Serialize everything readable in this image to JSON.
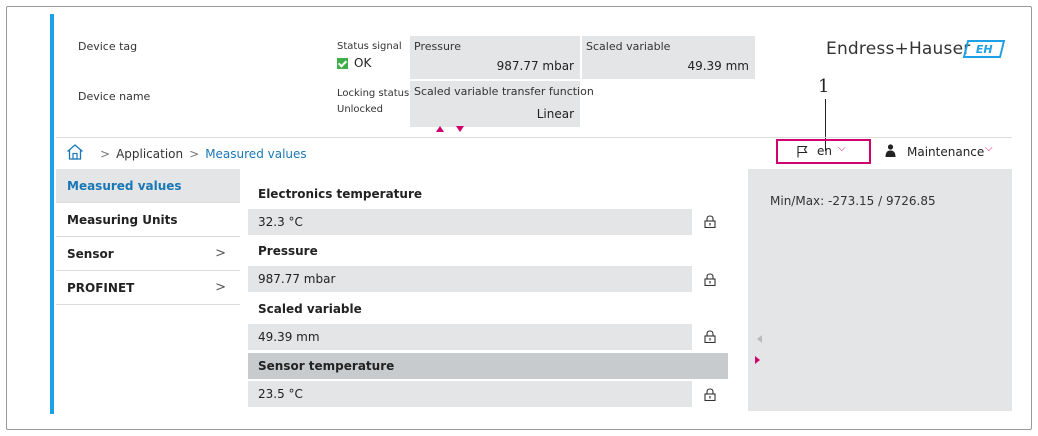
{
  "header": {
    "device_tag_label": "Device tag",
    "device_name_label": "Device name",
    "status_signal_label": "Status signal",
    "status_signal_value": "OK",
    "locking_status_label": "Locking status",
    "locking_status_value": "Unlocked",
    "tiles": {
      "pressure": {
        "label": "Pressure",
        "value": "987.77 mbar"
      },
      "scaled_variable": {
        "label": "Scaled variable",
        "value": "49.39 mm"
      },
      "transfer_function": {
        "label": "Scaled variable transfer function",
        "value": "Linear"
      }
    },
    "brand": "Endress+Hauser",
    "logo_text": "EH",
    "callout": "1"
  },
  "breadcrumb": {
    "items": [
      "Application",
      "Measured values"
    ],
    "separator": ">"
  },
  "toolbar": {
    "language": "en",
    "user_role": "Maintenance",
    "chevron": "⌵"
  },
  "sidebar": {
    "items": [
      {
        "label": "Measured values",
        "has_children": false
      },
      {
        "label": "Measuring Units",
        "has_children": false
      },
      {
        "label": "Sensor",
        "has_children": true,
        "chevron": ">"
      },
      {
        "label": "PROFINET",
        "has_children": true,
        "chevron": ">"
      }
    ]
  },
  "params": [
    {
      "label": "Electronics temperature",
      "value": "32.3 °C"
    },
    {
      "label": "Pressure",
      "value": "987.77 mbar"
    },
    {
      "label": "Scaled variable",
      "value": "49.39 mm"
    },
    {
      "label": "Sensor temperature",
      "value": "23.5 °C"
    }
  ],
  "help_panel": {
    "minmax": "Min/Max: -273.15 / 9726.85"
  },
  "colors": {
    "accent_blue": "#1da1e6",
    "accent_magenta": "#d0006f",
    "panel_gray": "#e3e5e7",
    "ok_green": "#3fae49"
  }
}
